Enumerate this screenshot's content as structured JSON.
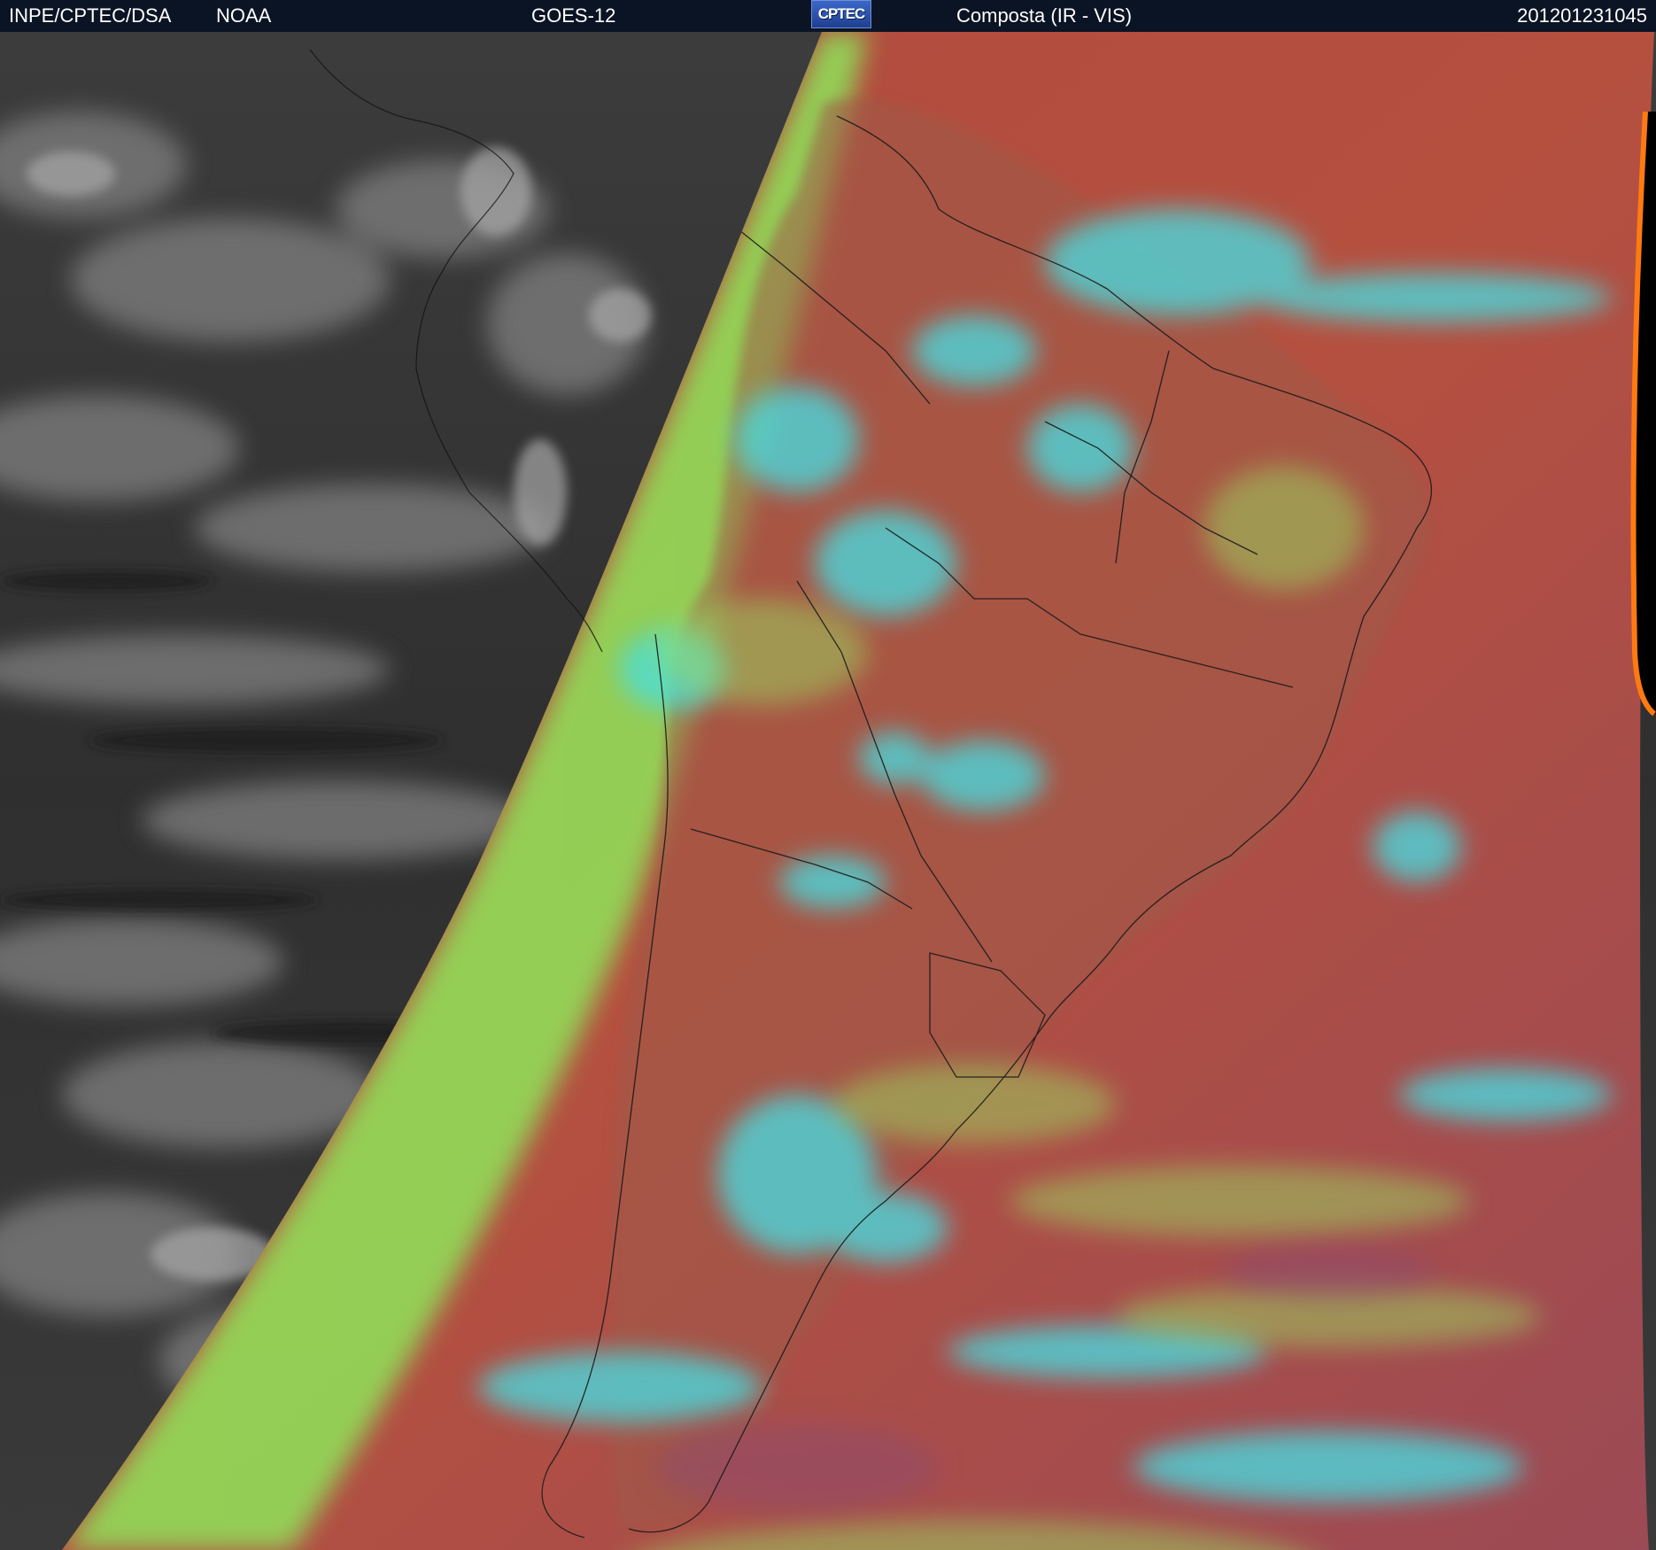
{
  "header": {
    "organization": "INPE/CPTEC/DSA",
    "agency": "NOAA",
    "satellite": "GOES-12",
    "logo_text": "CPTEC",
    "product": "Composta (IR - VIS)",
    "timestamp": "201201231045"
  },
  "colors": {
    "header_bg": "#0b1424",
    "night_ir": "#3a3a3a",
    "ir_cloud": "#9a9a9a",
    "ocean_warm": "#b24a3e",
    "land_warm": "#a55643",
    "cloud_cold": "#45e0e6",
    "terminator_band": "#8fe45a",
    "limb": "#ff7a10"
  }
}
